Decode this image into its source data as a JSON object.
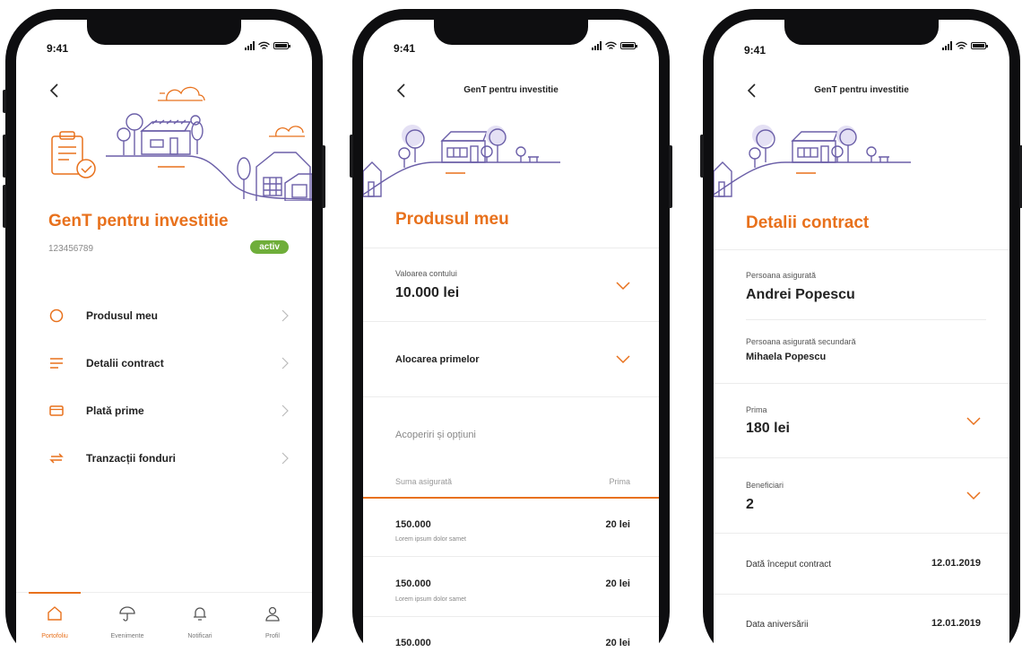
{
  "status": {
    "time": "9:41"
  },
  "screen1": {
    "title": "GenT pentru investitie",
    "policy_number": "123456789",
    "status_badge": "activ",
    "menu": [
      {
        "label": "Produsul meu",
        "icon": "circle-icon"
      },
      {
        "label": "Detalii contract",
        "icon": "list-icon"
      },
      {
        "label": "Plată prime",
        "icon": "card-icon"
      },
      {
        "label": "Tranzacții fonduri",
        "icon": "transfer-icon"
      }
    ],
    "tabs": [
      {
        "label": "Portofoliu",
        "icon": "home-icon",
        "active": true
      },
      {
        "label": "Evenimente",
        "icon": "umbrella-icon",
        "active": false
      },
      {
        "label": "Notificari",
        "icon": "bell-icon",
        "active": false
      },
      {
        "label": "Profil",
        "icon": "user-icon",
        "active": false
      }
    ]
  },
  "screen2": {
    "nav_title": "GenT pentru investitie",
    "title": "Produsul meu",
    "account_value_label": "Valoarea contului",
    "account_value": "10.000 lei",
    "allocation_label": "Alocarea  primelor",
    "coverage_heading": "Acoperiri și opțiuni",
    "columns": {
      "sum_insured": "Suma asigurată",
      "premium": "Prima"
    },
    "rows": [
      {
        "amount": "150.000",
        "description": "Lorem ipsum dolor samet",
        "premium": "20 lei"
      },
      {
        "amount": "150.000",
        "description": "Lorem ipsum dolor samet",
        "premium": "20 lei"
      },
      {
        "amount": "150.000",
        "description": "",
        "premium": "20 lei"
      }
    ]
  },
  "screen3": {
    "nav_title": "GenT pentru investitie",
    "title": "Detalii contract",
    "insured_label": "Persoana asigurată",
    "insured_name": "Andrei Popescu",
    "secondary_label": "Persoana asigurată secundară",
    "secondary_name": "Mihaela Popescu",
    "premium_label": "Prima",
    "premium_value": "180 lei",
    "beneficiaries_label": "Beneficiari",
    "beneficiaries_value": "2",
    "start_label": "Dată început contract",
    "start_value": "12.01.2019",
    "anniversary_label": "Data aniversării",
    "anniversary_value": "12.01.2019"
  },
  "colors": {
    "accent": "#e8711c",
    "illustration": "#6b5fa8",
    "badge": "#6fae3a"
  }
}
